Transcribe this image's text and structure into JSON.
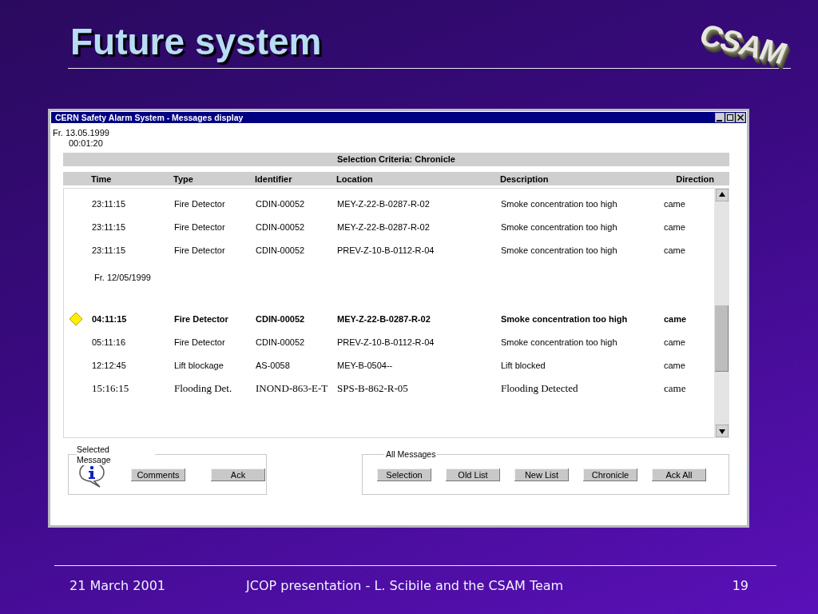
{
  "slide": {
    "title": "Future system",
    "logo": "CSAM"
  },
  "window": {
    "title": "CERN Safety Alarm System - Messages display",
    "date": "Fr. 13.05.1999",
    "time": "00:01:20",
    "criteria": "Selection Criteria: Chronicle"
  },
  "table": {
    "columns": [
      "Time",
      "Type",
      "Identifier",
      "Location",
      "Description",
      "Direction"
    ],
    "rows": [
      {
        "kind": "message",
        "highlighted": false,
        "cells": [
          "23:11:15",
          "Fire Detector",
          "CDIN-00052",
          "MEY-Z-22-B-0287-R-02",
          "Smoke concentration too high",
          "came"
        ]
      },
      {
        "kind": "message",
        "highlighted": false,
        "cells": [
          "23:11:15",
          "Fire Detector",
          "CDIN-00052",
          "MEY-Z-22-B-0287-R-02",
          "Smoke concentration too high",
          "came"
        ]
      },
      {
        "kind": "message",
        "highlighted": false,
        "cells": [
          "23:11:15",
          "Fire Detector",
          "CDIN-00052",
          "PREV-Z-10-B-0112-R-04",
          "Smoke concentration too high",
          "came"
        ]
      },
      {
        "kind": "date",
        "text": "Fr. 12/05/1999"
      },
      {
        "kind": "message",
        "highlighted": true,
        "cells": [
          "04:11:15",
          "Fire Detector",
          "CDIN-00052",
          "MEY-Z-22-B-0287-R-02",
          "Smoke concentration too high",
          "came"
        ]
      },
      {
        "kind": "message",
        "highlighted": false,
        "cells": [
          "05:11:16",
          "Fire Detector",
          "CDIN-00052",
          "PREV-Z-10-B-0112-R-04",
          "Smoke concentration too high",
          "came"
        ]
      },
      {
        "kind": "message",
        "highlighted": false,
        "cells": [
          "12:12:45",
          "Lift blockage",
          "AS-0058",
          "MEY-B-0504--",
          "Lift blocked",
          "came"
        ]
      },
      {
        "kind": "plain",
        "highlighted": false,
        "cells": [
          "15:16:15",
          "Flooding Det.",
          "INOND-863-E-T",
          "SPS-B-862-R-05",
          "Flooding Detected",
          "came"
        ]
      }
    ]
  },
  "groups": [
    {
      "kind": "selected",
      "title": "Selected Message",
      "buttons": [
        "Comments",
        "Ack"
      ]
    },
    {
      "kind": "all",
      "title": "All Messages",
      "buttons": [
        "Selection",
        "Old List",
        "New List",
        "Chronicle",
        "Ack All"
      ]
    }
  ],
  "footer": {
    "date": "21 March 2001",
    "text": "JCOP presentation - L. Scibile and the CSAM Team",
    "page": "19"
  }
}
